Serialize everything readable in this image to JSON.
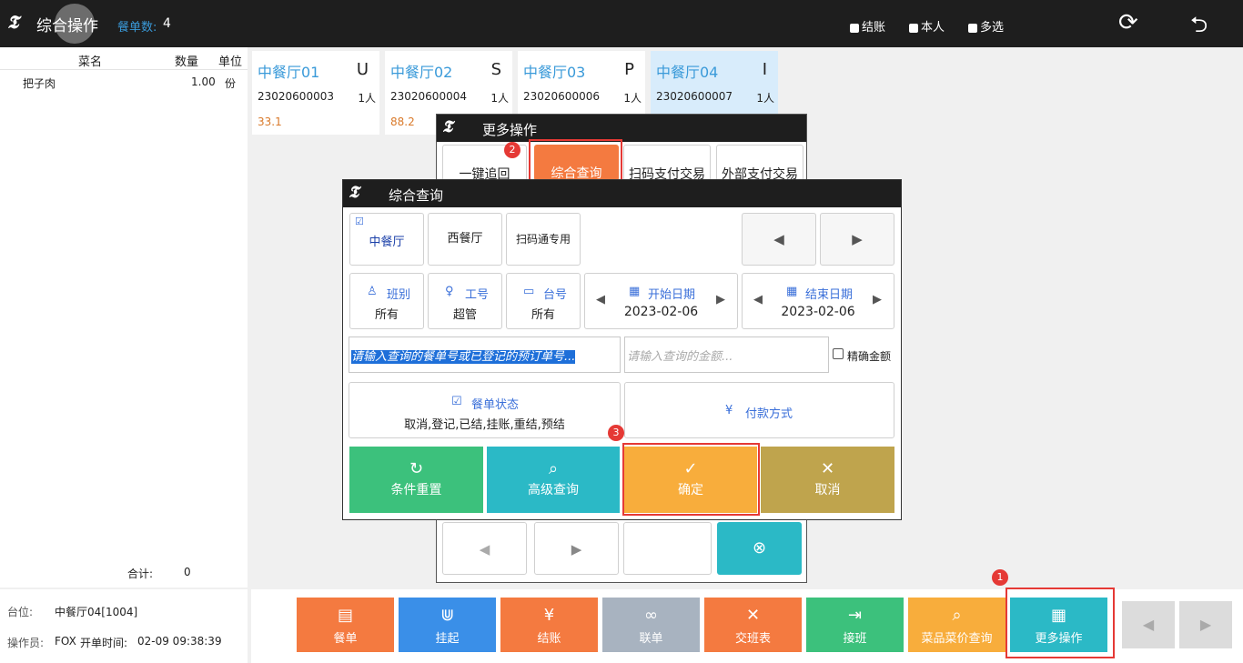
{
  "topbar": {
    "logo": "𝕿",
    "title": "综合操作",
    "order_count_label": "餐单数:",
    "order_count": "4",
    "checkbox_settle": "结账",
    "checkbox_self": "本人",
    "checkbox_multi": "多选",
    "refresh_icon": "⟳",
    "back_icon": "⮌"
  },
  "order_list": {
    "headers": [
      "菜名",
      "数量",
      "单位"
    ],
    "items": [
      {
        "name": "把子肉",
        "qty": "1.00",
        "unit": "份"
      }
    ],
    "total_label": "合计:",
    "total_value": "0"
  },
  "info": {
    "table_label": "台位:",
    "table_value": "中餐厅04[1004]",
    "operator_label": "操作员:",
    "operator_value": "FOX",
    "open_time_label": "开单时间:",
    "open_time_value": "02-09 09:38:39"
  },
  "tiles": [
    {
      "name": "中餐厅01",
      "letter": "U",
      "no": "23020600003",
      "persons": "1人",
      "amount": "33.1"
    },
    {
      "name": "中餐厅02",
      "letter": "S",
      "no": "23020600004",
      "persons": "1人",
      "amount": "88.2"
    },
    {
      "name": "中餐厅03",
      "letter": "P",
      "no": "23020600006",
      "persons": "1人",
      "amount": ""
    },
    {
      "name": "中餐厅04",
      "letter": "I",
      "no": "23020600007",
      "persons": "1人",
      "amount": ""
    }
  ],
  "bottom_buttons": [
    {
      "label": "餐单",
      "icon": "▤",
      "color": "#f47a40"
    },
    {
      "label": "挂起",
      "icon": "⋓",
      "color": "#3a8fe8"
    },
    {
      "label": "结账",
      "icon": "¥",
      "color": "#f47a40"
    },
    {
      "label": "联单",
      "icon": "∞",
      "color": "#a8b3c0"
    },
    {
      "label": "交班表",
      "icon": "✕",
      "color": "#f47a40"
    },
    {
      "label": "接班",
      "icon": "⇥",
      "color": "#3cc17c"
    },
    {
      "label": "菜品菜价查询",
      "icon": "⌕",
      "color": "#f8ad3c"
    },
    {
      "label": "更多操作",
      "icon": "▦",
      "color": "#2bb9c6"
    }
  ],
  "nav": {
    "prev": "◀",
    "next": "▶"
  },
  "more_modal": {
    "title": "更多操作",
    "buttons": [
      "一键追回",
      "综合查询",
      "扫码支付交易",
      "外部支付交易"
    ],
    "close_icon": "⊗"
  },
  "query_modal": {
    "title": "综合查询",
    "restaurants": [
      "中餐厅",
      "西餐厅",
      "扫码通专用"
    ],
    "selected_mark": "☑",
    "shift_label": "班别",
    "shift_value": "所有",
    "staff_label": "工号",
    "staff_value": "超管",
    "table_label": "台号",
    "table_value": "所有",
    "start_label": "开始日期",
    "start_value": "2023-02-06",
    "end_label": "结束日期",
    "end_value": "2023-02-06",
    "order_placeholder": "请输入查询的餐单号或已登记的预订单号...",
    "amount_placeholder": "请输入查询的金额...",
    "exact_label": "精确金额",
    "status_label": "餐单状态",
    "status_value": "取消,登记,已结,挂账,重结,预结",
    "payment_label": "付款方式",
    "reset_label": "条件重置",
    "advanced_label": "高级查询",
    "confirm_label": "确定",
    "cancel_label": "取消"
  },
  "badges": [
    "1",
    "2",
    "3"
  ]
}
